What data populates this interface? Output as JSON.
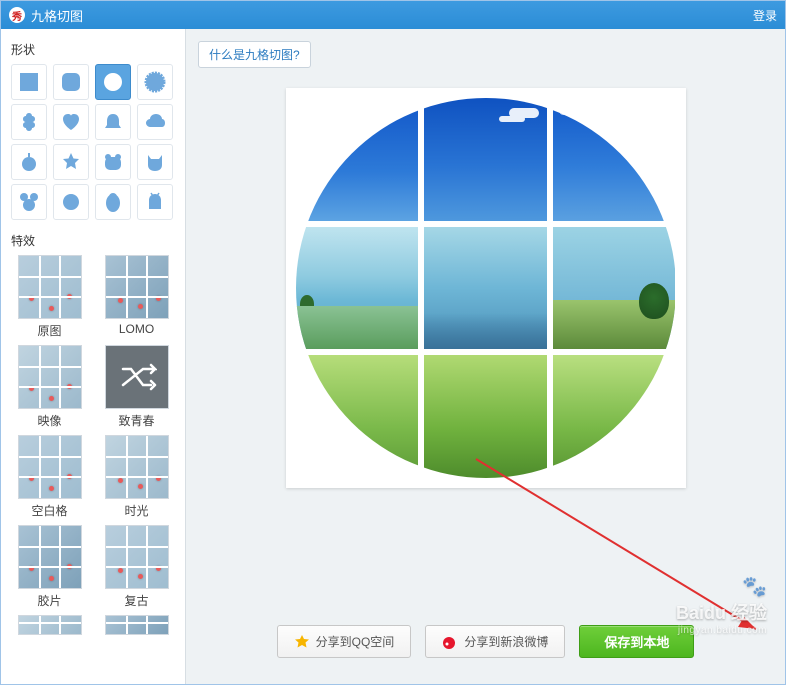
{
  "titlebar": {
    "app_icon_char": "秀",
    "title": "九格切图",
    "login": "登录"
  },
  "sidebar": {
    "shape_label": "形状",
    "effects_label": "特效",
    "selected_shape_index": 2,
    "effects": [
      {
        "label": "原图"
      },
      {
        "label": "LOMO"
      },
      {
        "label": "映像"
      },
      {
        "label": "致青春"
      },
      {
        "label": "空白格"
      },
      {
        "label": "时光"
      },
      {
        "label": "胶片"
      },
      {
        "label": "复古"
      }
    ]
  },
  "main": {
    "help_link": "什么是九格切图?"
  },
  "footer": {
    "share_qzone": "分享到QQ空间",
    "share_weibo": "分享到新浪微博",
    "save_local": "保存到本地"
  },
  "watermark": {
    "brand": "Baidu 经验",
    "sub": "jingyan.baidu.com"
  }
}
